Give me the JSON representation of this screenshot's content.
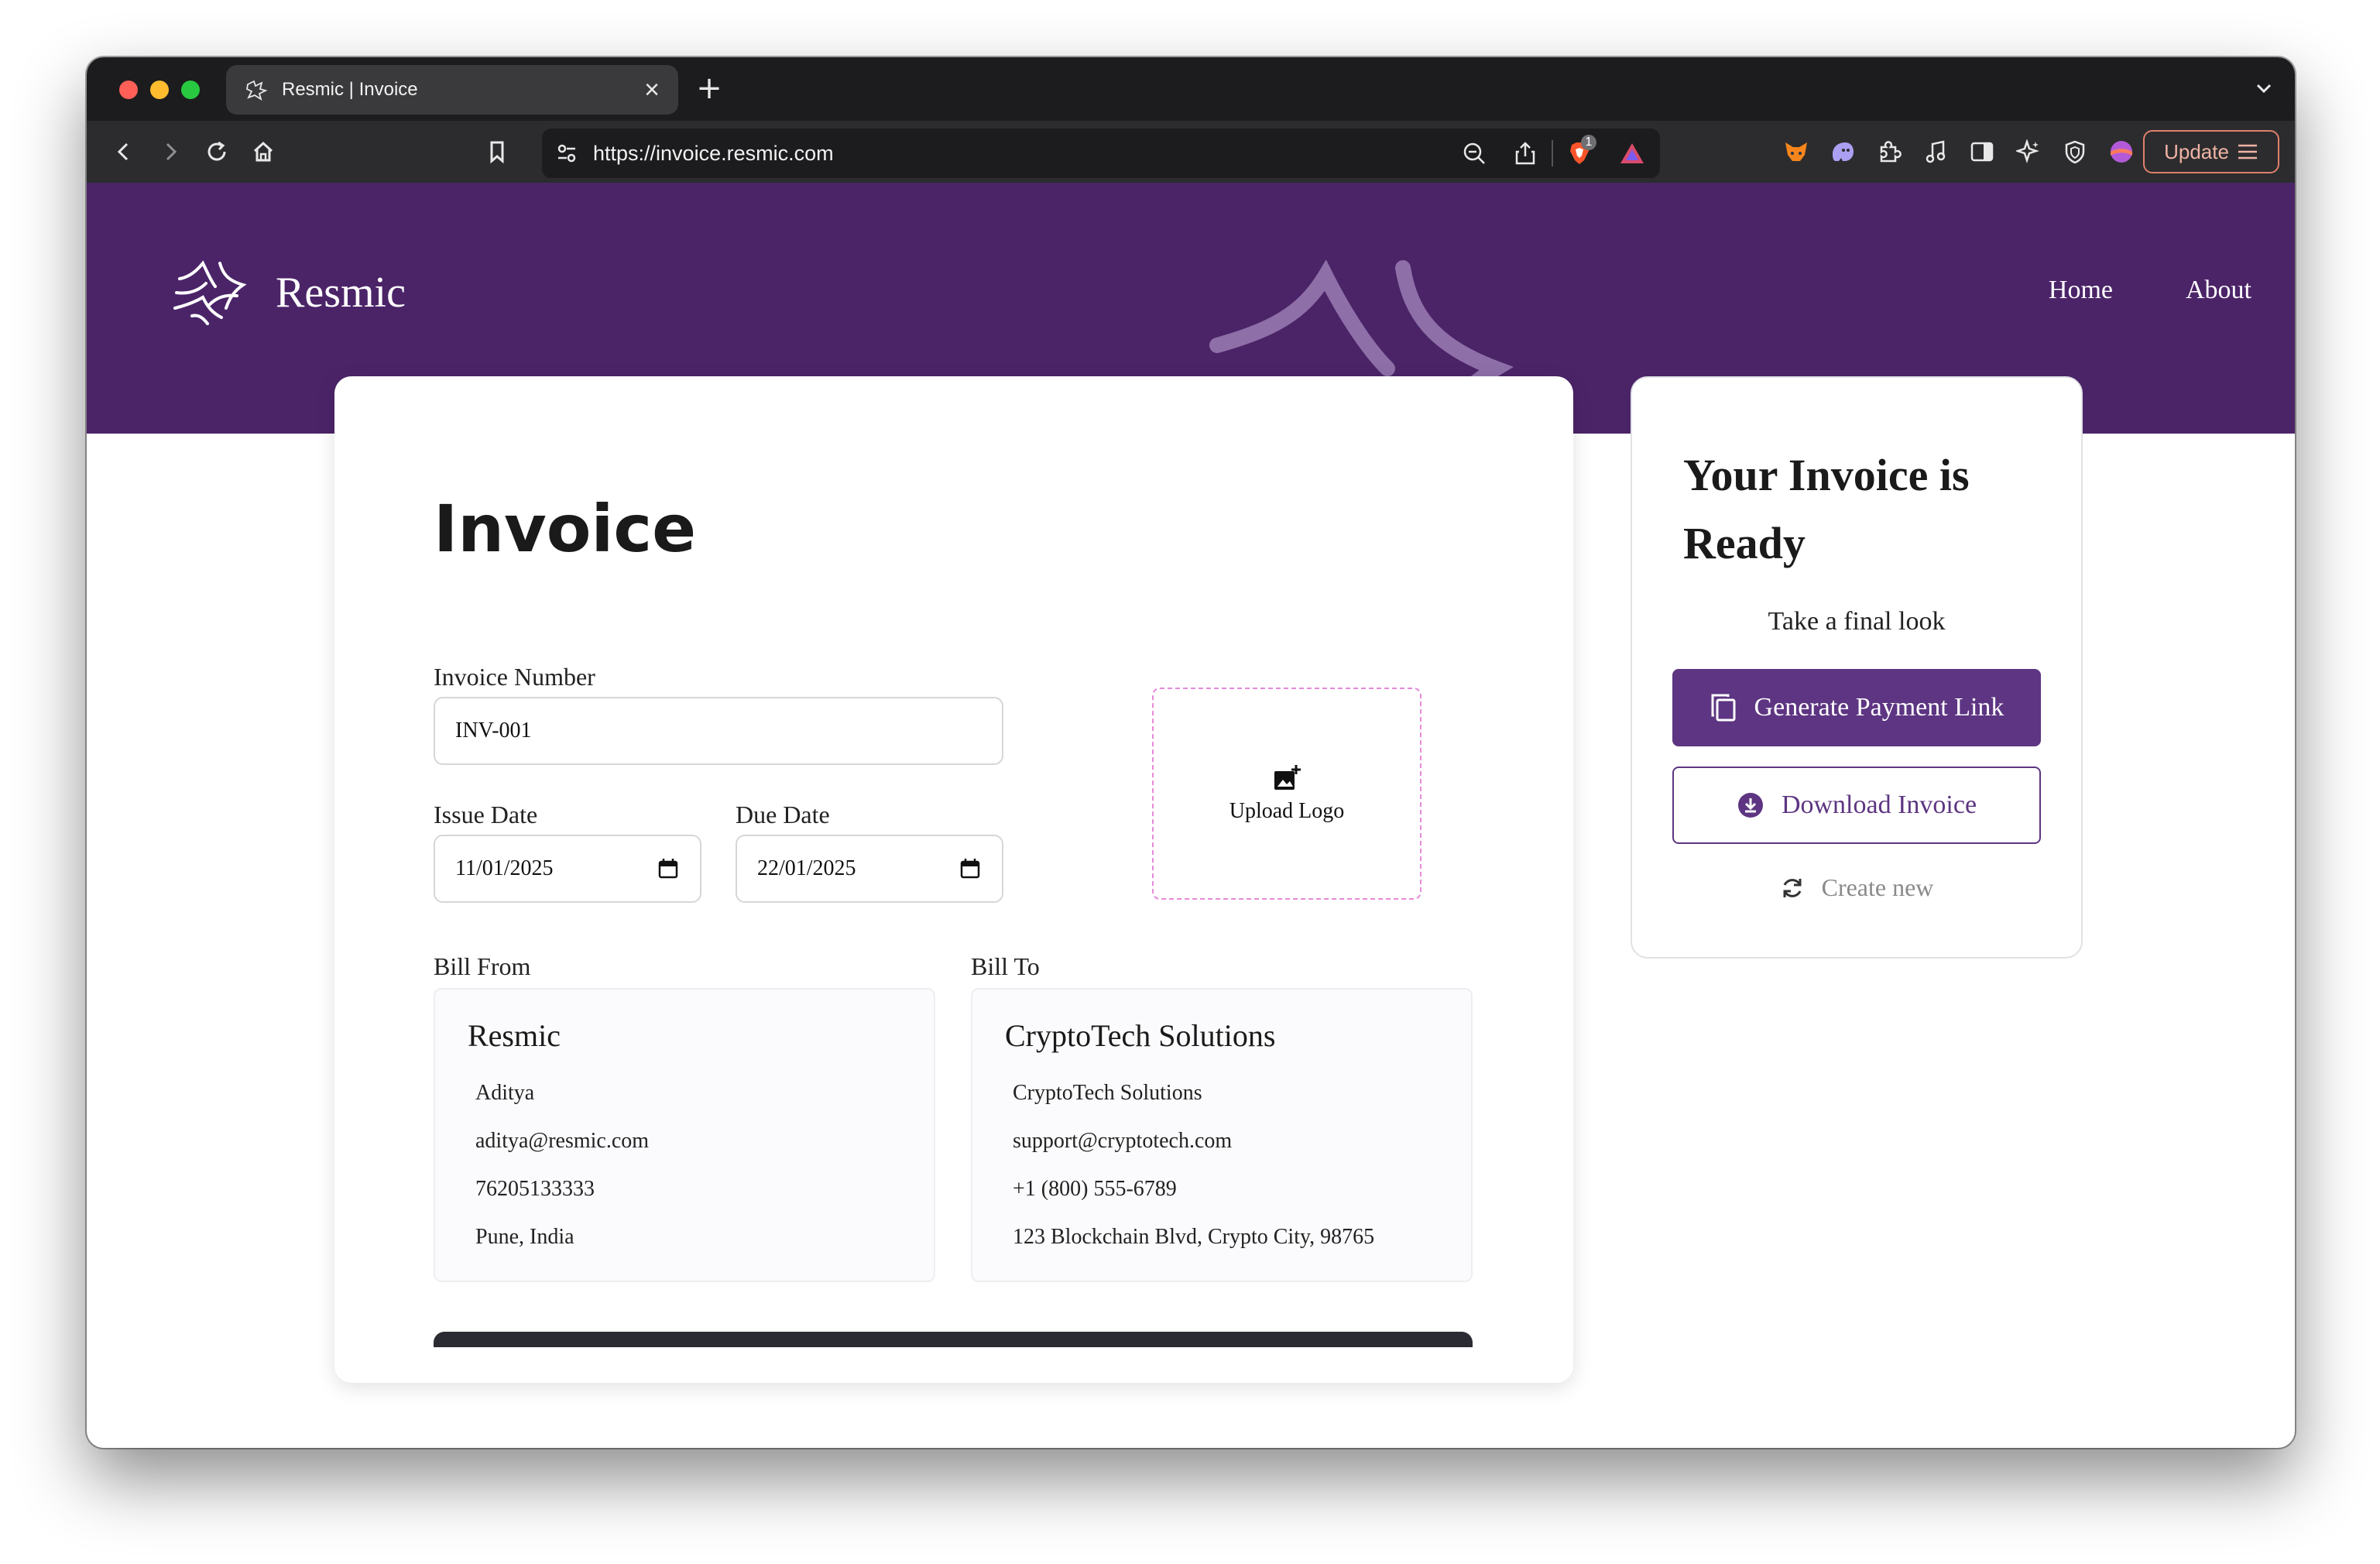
{
  "browser": {
    "tab_title": "Resmic | Invoice",
    "url": "https://invoice.resmic.com",
    "update_label": "Update",
    "extension_badge": "1"
  },
  "site": {
    "brand": "Resmic",
    "nav": [
      "Home",
      "About"
    ]
  },
  "invoice": {
    "title": "Invoice",
    "invoice_number_label": "Invoice Number",
    "invoice_number": "INV-001",
    "issue_date_label": "Issue Date",
    "issue_date": "11/01/2025",
    "due_date_label": "Due Date",
    "due_date": "22/01/2025",
    "upload_logo_label": "Upload Logo",
    "bill_from_label": "Bill From",
    "bill_from": {
      "name": "Resmic",
      "contact": "Aditya",
      "email": "aditya@resmic.com",
      "phone": "76205133333",
      "address": "Pune, India"
    },
    "bill_to_label": "Bill To",
    "bill_to": {
      "name": "CryptoTech Solutions",
      "contact": "CryptoTech Solutions",
      "email": "support@cryptotech.com",
      "phone": "+1 (800) 555-6789",
      "address": "123 Blockchain Blvd, Crypto City, 98765"
    }
  },
  "ready_panel": {
    "title": "Your Invoice is Ready",
    "subtitle": "Take a final look",
    "generate_label": "Generate Payment Link",
    "download_label": "Download Invoice",
    "create_new_label": "Create new"
  },
  "colors": {
    "header_purple": "#4b2468",
    "accent_purple": "#5d3582",
    "upload_border": "#e58ad8"
  }
}
